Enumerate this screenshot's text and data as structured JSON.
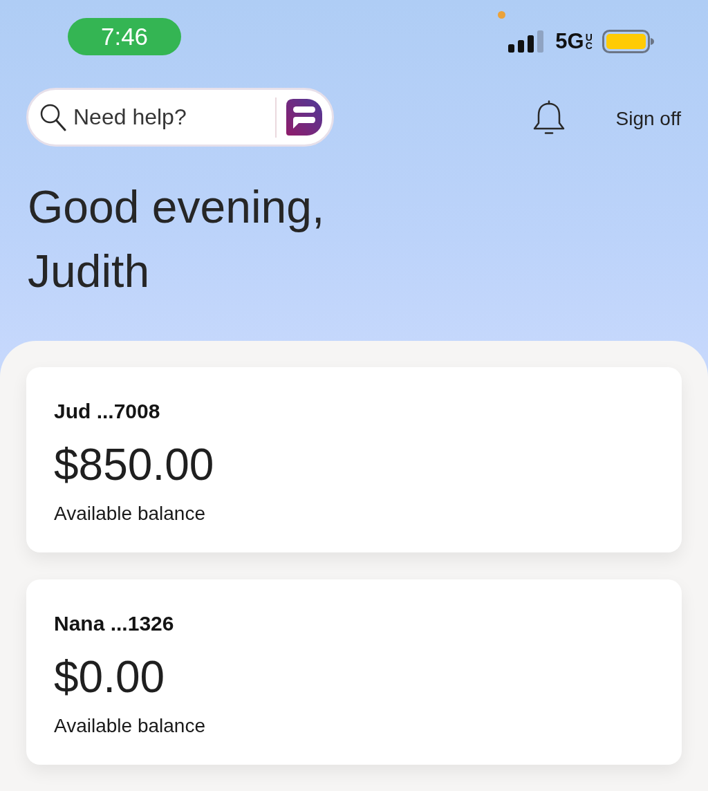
{
  "status_bar": {
    "time": "7:46",
    "network": "5G",
    "network_badge": "UC"
  },
  "header": {
    "search": {
      "placeholder": "Need help?"
    },
    "sign_off": "Sign off"
  },
  "greeting": "Good evening, Judith",
  "accounts": [
    {
      "name": "Jud ...7008",
      "balance": "$850.00",
      "label": "Available balance"
    },
    {
      "name": "Nana ...1326",
      "balance": "$0.00",
      "label": "Available balance"
    }
  ]
}
